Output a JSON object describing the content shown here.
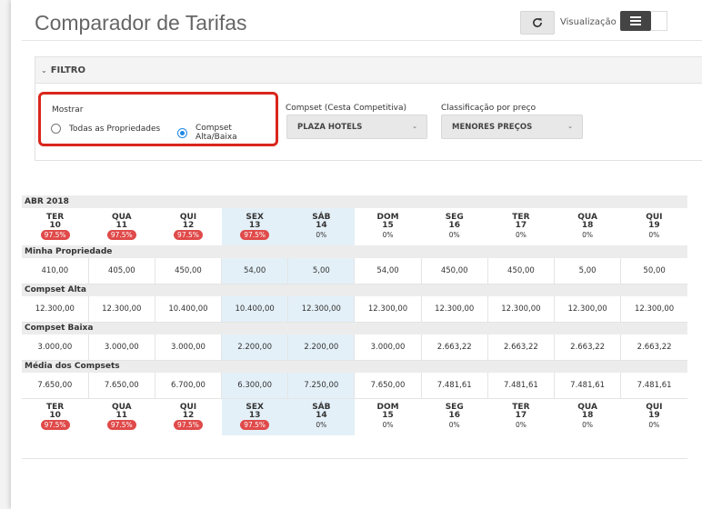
{
  "header": {
    "title": "Comparador de Tarifas",
    "view_label": "Visualização"
  },
  "filter": {
    "heading": "FILTRO",
    "mostrar": {
      "label": "Mostrar",
      "options": [
        "Todas as Propriedades",
        "Compset Alta/Baixa"
      ],
      "selected": 1
    },
    "compset": {
      "label": "Compset (Cesta Competitiva)",
      "value": "PLAZA HOTELS"
    },
    "classificacao": {
      "label": "Classificação por preço",
      "value": "MENORES PREÇOS"
    }
  },
  "table": {
    "month": "ABR 2018",
    "days": [
      {
        "dow": "TER",
        "day": "10",
        "pct": "97.5%",
        "alert": true,
        "hl": false
      },
      {
        "dow": "QUA",
        "day": "11",
        "pct": "97.5%",
        "alert": true,
        "hl": false
      },
      {
        "dow": "QUI",
        "day": "12",
        "pct": "97.5%",
        "alert": true,
        "hl": false
      },
      {
        "dow": "SEX",
        "day": "13",
        "pct": "97.5%",
        "alert": true,
        "hl": true
      },
      {
        "dow": "SÁB",
        "day": "14",
        "pct": "0%",
        "alert": false,
        "hl": true
      },
      {
        "dow": "DOM",
        "day": "15",
        "pct": "0%",
        "alert": false,
        "hl": false
      },
      {
        "dow": "SEG",
        "day": "16",
        "pct": "0%",
        "alert": false,
        "hl": false
      },
      {
        "dow": "TER",
        "day": "17",
        "pct": "0%",
        "alert": false,
        "hl": false
      },
      {
        "dow": "QUA",
        "day": "18",
        "pct": "0%",
        "alert": false,
        "hl": false
      },
      {
        "dow": "QUI",
        "day": "19",
        "pct": "0%",
        "alert": false,
        "hl": false
      }
    ],
    "sections": [
      {
        "label": "Minha Propriedade",
        "values": [
          "410,00",
          "405,00",
          "450,00",
          "54,00",
          "5,00",
          "54,00",
          "450,00",
          "450,00",
          "5,00",
          "50,00"
        ]
      },
      {
        "label": "Compset Alta",
        "values": [
          "12.300,00",
          "12.300,00",
          "10.400,00",
          "10.400,00",
          "12.300,00",
          "12.300,00",
          "12.300,00",
          "12.300,00",
          "12.300,00",
          "12.300,00"
        ]
      },
      {
        "label": "Compset Baixa",
        "values": [
          "3.000,00",
          "3.000,00",
          "3.000,00",
          "2.200,00",
          "2.200,00",
          "3.000,00",
          "2.663,22",
          "2.663,22",
          "2.663,22",
          "2.663,22"
        ]
      },
      {
        "label": "Média dos Compsets",
        "values": [
          "7.650,00",
          "7.650,00",
          "6.700,00",
          "6.300,00",
          "7.250,00",
          "7.650,00",
          "7.481,61",
          "7.481,61",
          "7.481,61",
          "7.481,61"
        ]
      }
    ]
  }
}
